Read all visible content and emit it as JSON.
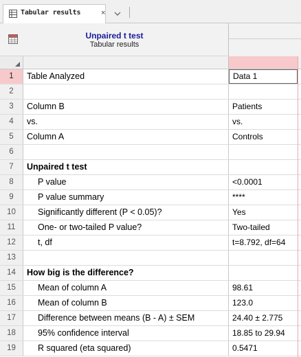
{
  "tab": {
    "label": "Tabular results",
    "close_glyph": "×",
    "menu_icon": "chevron-down-icon"
  },
  "header": {
    "title": "Unpaired t test",
    "subtitle": "Tabular results",
    "icon": "table-icon"
  },
  "colors": {
    "title": "#1a1a9a",
    "selected_column": "#f7c9cb"
  },
  "rows": [
    {
      "num": "1",
      "label": "Table Analyzed",
      "value": "Data 1",
      "style": "normal",
      "selected": true
    },
    {
      "num": "2",
      "label": "",
      "value": "",
      "style": "normal"
    },
    {
      "num": "3",
      "label": "Column B",
      "value": "Patients",
      "style": "normal"
    },
    {
      "num": "4",
      "label": "vs.",
      "value": "vs.",
      "style": "normal"
    },
    {
      "num": "5",
      "label": "Column A",
      "value": "Controls",
      "style": "normal"
    },
    {
      "num": "6",
      "label": "",
      "value": "",
      "style": "normal"
    },
    {
      "num": "7",
      "label": "Unpaired t test",
      "value": "",
      "style": "bold"
    },
    {
      "num": "8",
      "label": "P value",
      "value": "<0.0001",
      "style": "indent"
    },
    {
      "num": "9",
      "label": "P value summary",
      "value": "****",
      "style": "indent"
    },
    {
      "num": "10",
      "label": "Significantly different (P < 0.05)?",
      "value": "Yes",
      "style": "indent"
    },
    {
      "num": "11",
      "label": "One- or two-tailed P value?",
      "value": "Two-tailed",
      "style": "indent"
    },
    {
      "num": "12",
      "label": "t, df",
      "value": "t=8.792, df=64",
      "style": "indent"
    },
    {
      "num": "13",
      "label": "",
      "value": "",
      "style": "normal"
    },
    {
      "num": "14",
      "label": "How big is the difference?",
      "value": "",
      "style": "bold"
    },
    {
      "num": "15",
      "label": "Mean of column A",
      "value": "98.61",
      "style": "indent"
    },
    {
      "num": "16",
      "label": "Mean of column B",
      "value": "123.0",
      "style": "indent"
    },
    {
      "num": "17",
      "label": "Difference between means (B - A) ± SEM",
      "value": "24.40 ± 2.775",
      "style": "indent"
    },
    {
      "num": "18",
      "label": "95% confidence interval",
      "value": "18.85 to 29.94",
      "style": "indent"
    },
    {
      "num": "19",
      "label": "R squared (eta squared)",
      "value": "0.5471",
      "style": "indent"
    }
  ]
}
